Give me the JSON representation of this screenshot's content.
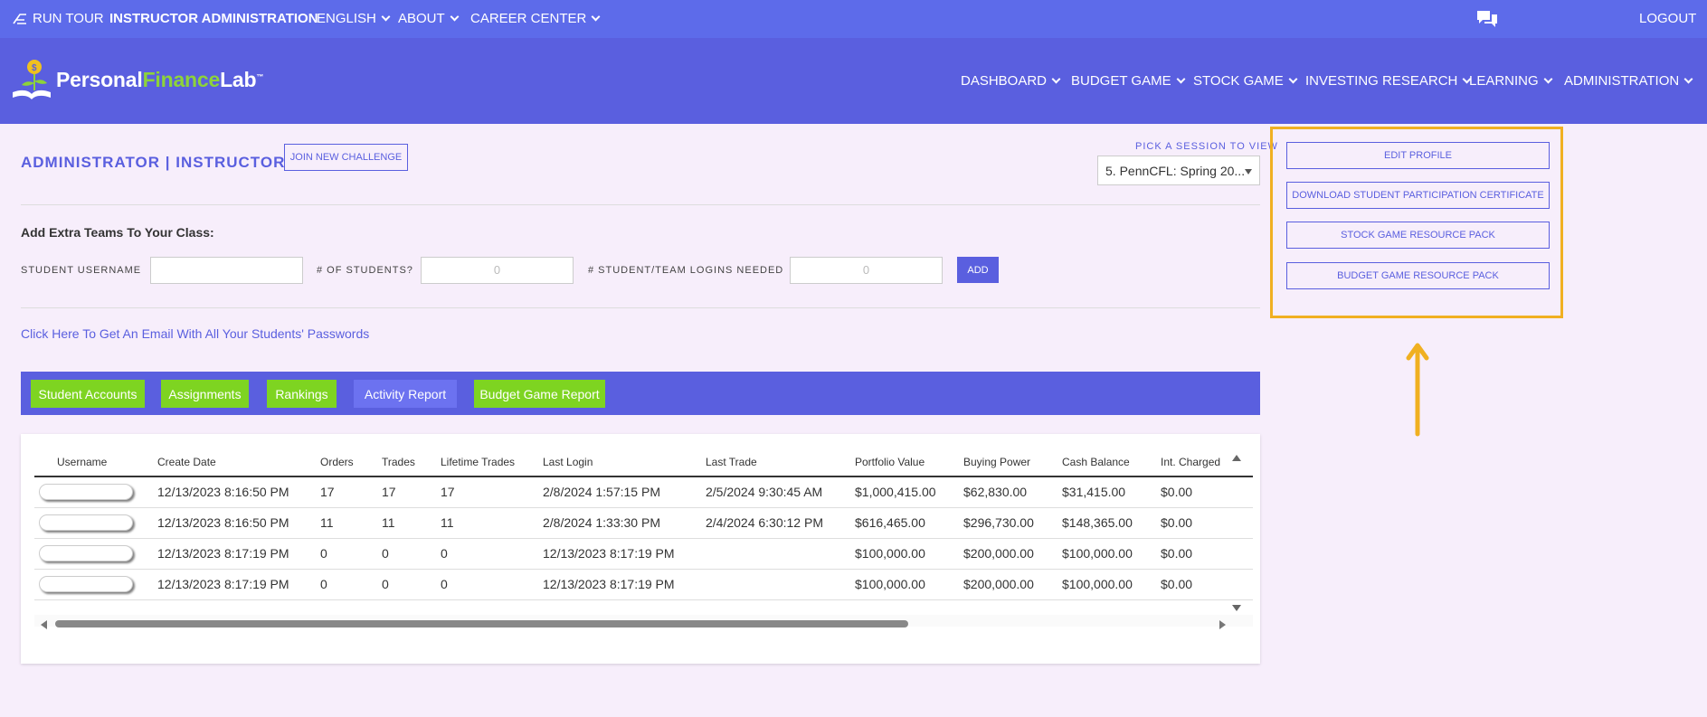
{
  "topbar": {
    "run_tour": "RUN TOUR",
    "instructor_admin": "INSTRUCTOR ADMINISTRATION",
    "english": "ENGLISH",
    "about": "ABOUT",
    "career_center": "CAREER CENTER",
    "logout": "LOGOUT"
  },
  "brand": {
    "part1": "Personal",
    "part2": "Finance",
    "part3": "Lab",
    "tm": "™"
  },
  "nav": [
    "DASHBOARD",
    "BUDGET GAME",
    "STOCK GAME",
    "INVESTING RESEARCH",
    "LEARNING",
    "ADMINISTRATION"
  ],
  "main": {
    "title": "ADMINISTRATOR | INSTRUCTOR",
    "join_button": "JOIN NEW CHALLENGE",
    "session_label": "PICK A SESSION TO VIEW",
    "session_value": "5. PennCFL: Spring 20...",
    "extra_teams_title": "Add Extra Teams To Your Class:",
    "student_username_label": "STUDENT USERNAME",
    "num_students_label": "# OF STUDENTS?",
    "num_students_placeholder": "0",
    "logins_label": "# STUDENT/TEAM LOGINS NEEDED",
    "logins_placeholder": "0",
    "add_button": "ADD",
    "email_link": "Click Here To Get An Email With All Your Students' Passwords"
  },
  "tabs": [
    "Student Accounts",
    "Assignments",
    "Rankings",
    "Activity Report",
    "Budget Game Report"
  ],
  "table": {
    "headers": [
      "Username",
      "Create Date",
      "Orders",
      "Trades",
      "Lifetime Trades",
      "Last Login",
      "Last Trade",
      "Portfolio Value",
      "Buying Power",
      "Cash Balance",
      "Int. Charged"
    ],
    "rows": [
      [
        "12/13/2023 8:16:50 PM",
        "17",
        "17",
        "17",
        "2/8/2024 1:57:15 PM",
        "2/5/2024 9:30:45 AM",
        "$1,000,415.00",
        "$62,830.00",
        "$31,415.00",
        "$0.00"
      ],
      [
        "12/13/2023 8:16:50 PM",
        "11",
        "11",
        "11",
        "2/8/2024 1:33:30 PM",
        "2/4/2024 6:30:12 PM",
        "$616,465.00",
        "$296,730.00",
        "$148,365.00",
        "$0.00"
      ],
      [
        "12/13/2023 8:17:19 PM",
        "0",
        "0",
        "0",
        "12/13/2023 8:17:19 PM",
        "",
        "$100,000.00",
        "$200,000.00",
        "$100,000.00",
        "$0.00"
      ],
      [
        "12/13/2023 8:17:19 PM",
        "0",
        "0",
        "0",
        "12/13/2023 8:17:19 PM",
        "",
        "$100,000.00",
        "$200,000.00",
        "$100,000.00",
        "$0.00"
      ]
    ]
  },
  "panel": {
    "buttons": [
      "EDIT PROFILE",
      "DOWNLOAD STUDENT PARTICIPATION CERTIFICATE",
      "STOCK GAME RESOURCE PACK",
      "BUDGET GAME RESOURCE PACK"
    ],
    "highlight_color": "#f0b021"
  },
  "colors": {
    "primary": "#5a5fdf",
    "topbar": "#5d6bea",
    "tab_green": "#7ed421",
    "background": "#f7eefb"
  },
  "icons": [
    "tour-icon",
    "chat-icon",
    "chevron-down-icon",
    "plant-logo-icon"
  ]
}
